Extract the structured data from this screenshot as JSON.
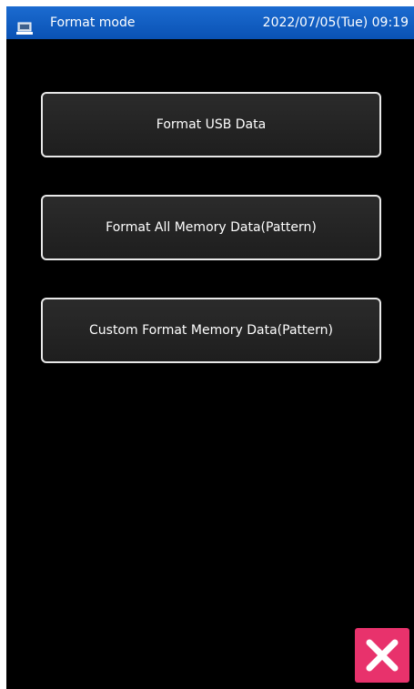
{
  "title_bar": {
    "title": "Format mode",
    "datetime": "2022/07/05(Tue) 09:19",
    "icon": "computer-icon"
  },
  "menu": {
    "buttons": [
      {
        "label": "Format USB Data"
      },
      {
        "label": "Format All Memory Data(Pattern)"
      },
      {
        "label": "Custom Format Memory Data(Pattern)"
      }
    ]
  },
  "close_button": {
    "icon": "close-icon",
    "color": "#e8326c"
  },
  "colors": {
    "title_bar": "#0a52b4",
    "background": "#000000",
    "button_border": "#e8e8e8"
  }
}
